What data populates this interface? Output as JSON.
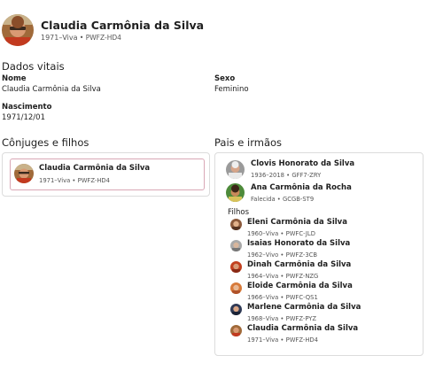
{
  "header": {
    "name": "Claudia Carmônia da Silva",
    "years": "1971–Viva",
    "separator": "•",
    "id": "PWFZ-HD4"
  },
  "vitals": {
    "title": "Dados vitais",
    "name_label": "Nome",
    "name_value": "Claudia Carmônia da Silva",
    "sex_label": "Sexo",
    "sex_value": "Feminino",
    "birth_label": "Nascimento",
    "birth_value": "1971/12/01"
  },
  "spouses": {
    "title": "Cônjuges e filhos",
    "entry": {
      "name": "Claudia Carmônia da Silva",
      "meta": "1971–Viva • PWFZ-HD4"
    }
  },
  "parents": {
    "title": "Pais e irmãos",
    "father": {
      "name": "Clovis Honorato da Silva",
      "meta": "1936–2018 • GFF7-ZRY"
    },
    "mother": {
      "name": "Ana Carmônia da Rocha",
      "meta": "Falecida • GCGB-ST9"
    },
    "children_label": "Filhos",
    "children": [
      {
        "name": "Eleni Carmônia da Silva",
        "meta": "1960–Viva • PWFC-JLD"
      },
      {
        "name": "Isaias Honorato da Silva",
        "meta": "1962–Vivo • PWFZ-3CB"
      },
      {
        "name": "Dinah Carmônia da Silva",
        "meta": "1964–Viva • PWFZ-NZG"
      },
      {
        "name": "Eloide Carmônia da Silva",
        "meta": "1966–Viva • PWFC-QS1"
      },
      {
        "name": "Marlene Carmônia da Silva",
        "meta": "1968–Viva • PWFZ-PYZ"
      },
      {
        "name": "Claudia Carmônia da Silva",
        "meta": "1971–Viva • PWFZ-HD4"
      }
    ]
  },
  "colors": {
    "accent_border": "#d9a7b6",
    "card_border": "#dcdcdc",
    "text": "#1f1f1f",
    "muted": "#555555"
  }
}
